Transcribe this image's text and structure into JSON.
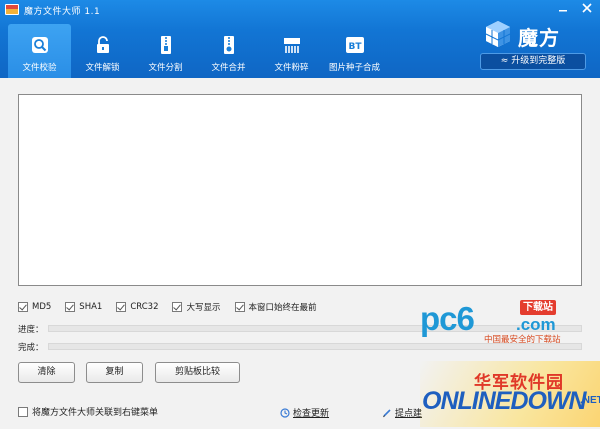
{
  "window": {
    "title": "魔方文件大师 1.1",
    "controls": [
      "minimize",
      "close"
    ]
  },
  "toolbar": {
    "active_index": 0,
    "items": [
      {
        "label": "文件校验",
        "icon": "verify-icon"
      },
      {
        "label": "文件解锁",
        "icon": "unlock-icon"
      },
      {
        "label": "文件分割",
        "icon": "zip-split-icon"
      },
      {
        "label": "文件合并",
        "icon": "zip-merge-icon"
      },
      {
        "label": "文件粉碎",
        "icon": "shredder-icon"
      },
      {
        "label": "图片种子合成",
        "icon": "bt-icon"
      }
    ]
  },
  "brand": {
    "name": "魔方",
    "upgrade_label": "升级到完整版"
  },
  "output": {
    "content": ""
  },
  "options": [
    {
      "label": "MD5",
      "checked": true
    },
    {
      "label": "SHA1",
      "checked": true
    },
    {
      "label": "CRC32",
      "checked": true
    },
    {
      "label": "大写显示",
      "checked": true
    },
    {
      "label": "本窗口始终在最前",
      "checked": true
    }
  ],
  "progress": {
    "progress_label": "进度：",
    "progress_value": 0,
    "complete_label": "完成：",
    "complete_value": 0
  },
  "buttons": {
    "clear": "清除",
    "copy": "复制",
    "compare": "剪贴板比较"
  },
  "footer": {
    "associate_label": "将魔方文件大师关联到右键菜单",
    "associate_checked": false,
    "check_update": "检查更新",
    "feedback": "提点建"
  },
  "watermarks": {
    "pc6_logo": "pc6",
    "pc6_tag": "下载站",
    "pc6_domain": ".com",
    "pc6_slogan": "中国最安全的下载站",
    "onlinedown_cn": "华军软件园",
    "onlinedown_en": "ONLINEDOWN",
    "onlinedown_net": ".NET"
  },
  "colors": {
    "toolbar_blue": "#1275d4",
    "active_tab": "#2a8ee6",
    "brand_dark": "#0b4fa0"
  }
}
